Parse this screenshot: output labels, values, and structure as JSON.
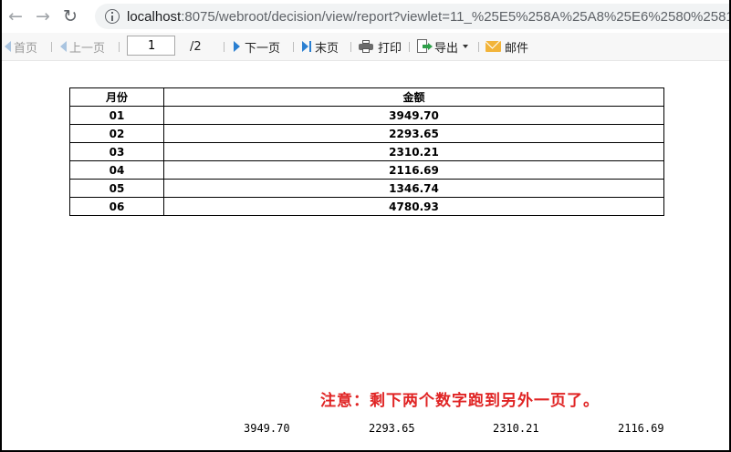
{
  "browser": {
    "url_host": "localhost",
    "url_path": ":8075/webroot/decision/view/report?viewlet=11_%25E5%258A%25A8%25E6%2580%2581"
  },
  "toolbar": {
    "first_page": "首页",
    "prev_page": "上一页",
    "page_input": "1",
    "page_total": "/2",
    "next_page": "下一页",
    "last_page": "末页",
    "print": "打印",
    "export": "导出",
    "email": "邮件"
  },
  "table": {
    "headers": [
      "月份",
      "金额"
    ],
    "rows": [
      [
        "01",
        "3949.70"
      ],
      [
        "02",
        "2293.65"
      ],
      [
        "03",
        "2310.21"
      ],
      [
        "04",
        "2116.69"
      ],
      [
        "05",
        "1346.74"
      ],
      [
        "06",
        "4780.93"
      ]
    ]
  },
  "note": "注意：剩下两个数字跑到另外一页了。",
  "overflow_values": [
    "3949.70",
    "2293.65",
    "2310.21",
    "2116.69"
  ],
  "colors": {
    "note": "#e02424",
    "nav_blue": "#2a7fd1"
  }
}
